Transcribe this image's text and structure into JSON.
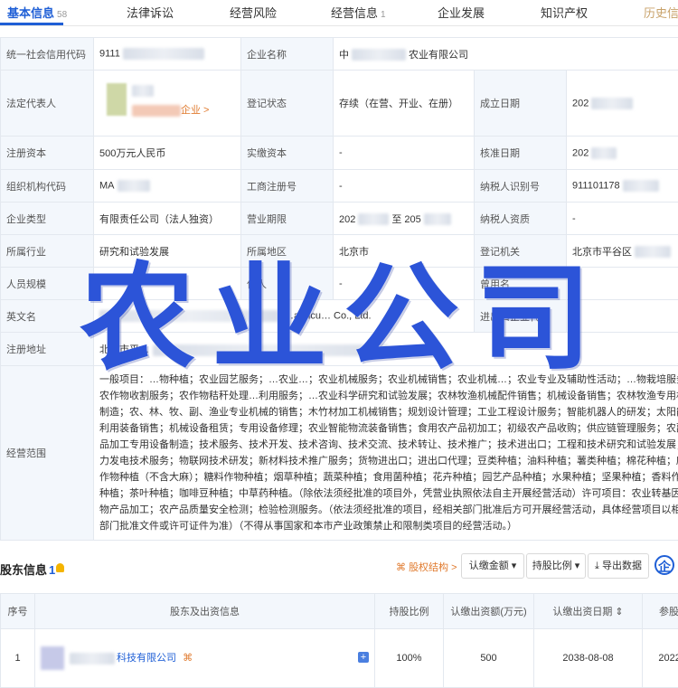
{
  "tabs": [
    {
      "label": "基本信息",
      "count": "58"
    },
    {
      "label": "法律诉讼"
    },
    {
      "label": "经营风险"
    },
    {
      "label": "经营信息",
      "count": "1"
    },
    {
      "label": "企业发展"
    },
    {
      "label": "知识产权"
    },
    {
      "label": "历史信"
    }
  ],
  "info": {
    "credit_code_label": "统一社会信用代码",
    "credit_code_value": "9111",
    "name_label": "企业名称",
    "name_prefix": "中",
    "name_suffix": "农业有限公司",
    "legal_rep_label": "法定代表人",
    "legal_rep_link": "企业 >",
    "status_label": "登记状态",
    "status_value": "存续（在营、开业、在册）",
    "est_date_label": "成立日期",
    "est_date_value": "202",
    "reg_capital_label": "注册资本",
    "reg_capital_value": "500万元人民币",
    "paid_capital_label": "实缴资本",
    "paid_capital_value": "-",
    "approve_date_label": "核准日期",
    "approve_date_value": "202",
    "org_code_label": "组织机构代码",
    "org_code_value": "MA",
    "biz_reg_label": "工商注册号",
    "biz_reg_value": "-",
    "taxpayer_id_label": "纳税人识别号",
    "taxpayer_id_value": "911101178",
    "type_label": "企业类型",
    "type_value": "有限责任公司（法人独资）",
    "term_label": "营业期限",
    "term_from": "202",
    "term_to": "至 205",
    "taxpayer_q_label": "纳税人资质",
    "taxpayer_q_value": "-",
    "industry_label": "所属行业",
    "industry_value": "研究和试验发展",
    "region_label": "所属地区",
    "region_value": "北京市",
    "authority_label": "登记机关",
    "authority_value": "北京市平谷区",
    "staff_label": "人员规模",
    "staff_value": "-",
    "insured_label": "保人",
    "insured_value": "-",
    "former_name_label": "曾用名",
    "former_name_value": "-",
    "en_name_label": "英文名",
    "en_name_value": "…agricu… Co., Ltd.",
    "ie_code_label": "进出口企业代码",
    "ie_code_value": "-",
    "address_label": "注册地址",
    "address_value": "北京市平…",
    "scope_label": "经营范围",
    "scope_value": "一般项目：…物种植；农业园艺服务；…农业…；农业机械服务；农业机械销售；农业机械…；农业专业及辅助性活动；…物栽培服务；农作物收割服务；农作物秸秆处理…利用服务；…农业科学研究和试验发展；农林牧渔机械配件销售；机械设备销售；农林牧渔专用机械制造；农、林、牧、副、渔业专业机械的销售；木竹材加工机械销售；规划设计管理；工业工程设计服务；智能机器人的研发；太阳能热利用装备销售；机械设备租赁；专用设备修理；农业智能物流装备销售；食用农产品初加工；初级农产品收购；供应链管理服务；农副食品加工专用设备制造；技术服务、技术开发、技术咨询、技术交流、技术转让、技术推广；技术进出口；工程和技术研究和试验发展；风力发电技术服务；物联网技术研发；新材料技术推广服务；货物进出口；进出口代理；豆类种植；油料种植；薯类种植；棉花种植；麻类作物种植（不含大麻）；糖料作物种植；烟草种植；蔬菜种植；食用菌种植；花卉种植；园艺产品种植；水果种植；坚果种植；香料作物种植；茶叶种植；咖啡豆种植；中草药种植。（除依法须经批准的项目外，凭营业执照依法自主开展经营活动）许可项目：农业转基因生物产品加工；农产品质量安全检测；检验检测服务。（依法须经批准的项目，经相关部门批准后方可开展经营活动，具体经营项目以相关部门批准文件或许可证件为准）（不得从事国家和本市产业政策禁止和限制类项目的经营活动。）"
  },
  "overlay_text": "农业公司",
  "shareholders": {
    "title": "股东信息",
    "count": "1",
    "equity_link": "股权结构 >",
    "buttons": [
      "认缴金额",
      "持股比例",
      "导出数据"
    ],
    "brand_icon": "企",
    "headers": [
      "序号",
      "股东及出资信息",
      "持股比例",
      "认缴出资额(万元)",
      "认缴出资日期",
      "参股日"
    ],
    "row": {
      "index": "1",
      "name_suffix": "科技有限公司",
      "ratio": "100%",
      "amount": "500",
      "date": "2038-08-08",
      "join_date": "2022-0"
    }
  },
  "colors": {
    "accent": "#1f5fd6",
    "overlay": "#2c54d8",
    "link": "#e07a2e",
    "label_bg": "#f3f7fc"
  },
  "icons": [
    "bell-icon",
    "equity-structure-icon",
    "download-icon",
    "plus-icon",
    "chevron-down-icon"
  ]
}
